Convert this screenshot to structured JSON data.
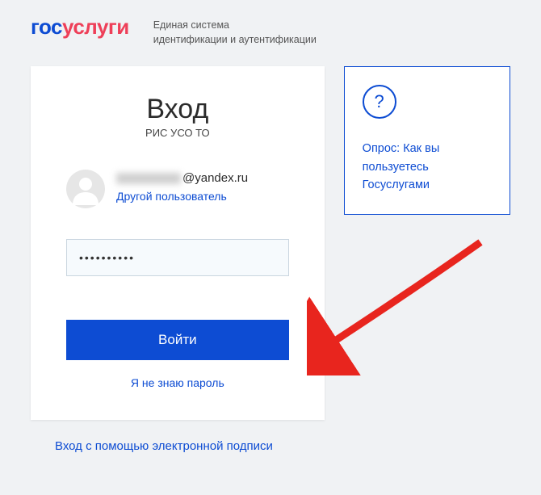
{
  "header": {
    "logo_gos": "гос",
    "logo_uslugi": "услуги",
    "tagline_line1": "Единая система",
    "tagline_line2": "идентификации и аутентификации"
  },
  "login": {
    "title": "Вход",
    "subtitle": "РИС УСО ТО",
    "email_domain": "@yandex.ru",
    "other_user": "Другой пользователь",
    "password_value": "••••••••••",
    "login_button": "Войти",
    "forgot_password": "Я не знаю пароль"
  },
  "sidebar": {
    "poll_text": "Опрос: Как вы пользуетесь Госуслугами"
  },
  "footer": {
    "esign_link": "Вход с помощью электронной подписи"
  },
  "colors": {
    "primary": "#0d4cd3",
    "accent": "#ee3f58"
  }
}
